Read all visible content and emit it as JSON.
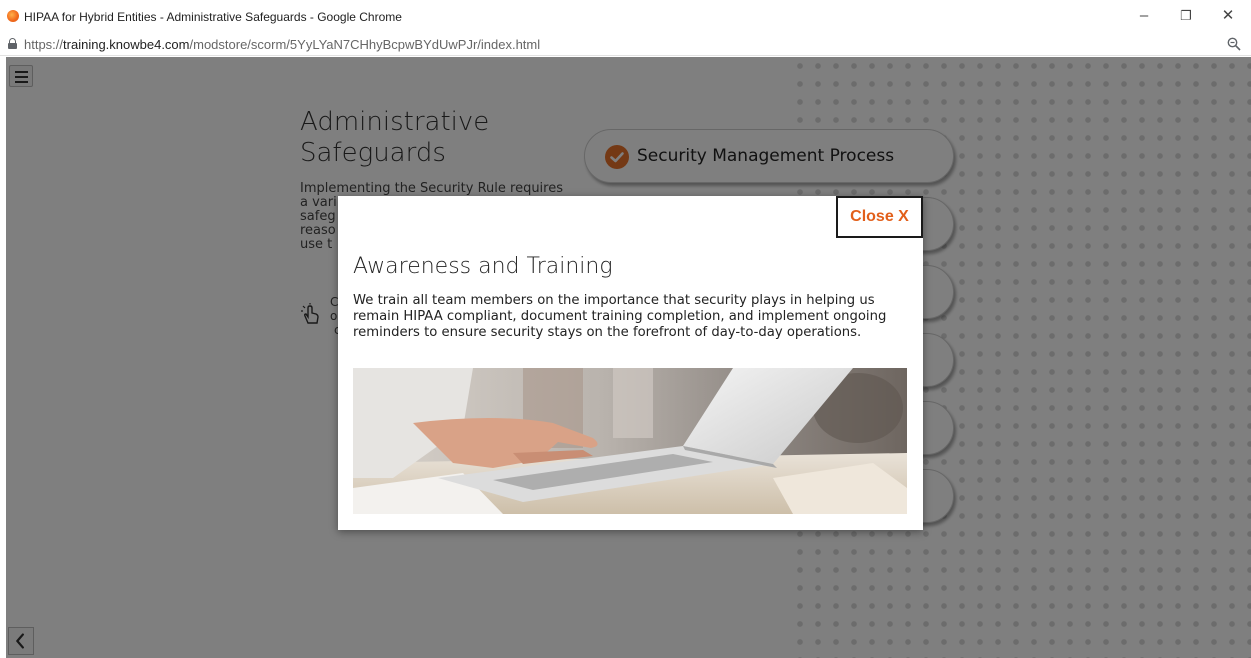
{
  "window": {
    "title": "HIPAA for Hybrid Entities - Administrative Safeguards - Google Chrome",
    "minimize_glyph": "–",
    "restore_glyph": "❐",
    "close_glyph": "✕"
  },
  "address_bar": {
    "url_scheme": "https://",
    "url_host": "training.knowbe4.com",
    "url_path": "/modstore/scorm/5YyLYaN7CHhyBcpwBYdUwPJr/index.html"
  },
  "page": {
    "title": "Administrative Safeguards",
    "intro_lines": [
      "Implementing the Security Rule requires",
      "a vari",
      "safeg",
      "reaso",
      "use t"
    ],
    "instruction_lines": [
      "C",
      "o",
      "c"
    ],
    "pills": [
      {
        "label": "Security Management Process",
        "completed": true
      }
    ],
    "back_glyph": "<"
  },
  "modal": {
    "close_label": "Close X",
    "title": "Awareness and Training",
    "body": "We train all team members on the importance that security plays in helping us remain HIPAA compliant, document training completion, and implement ongoing reminders to ensure security stays on the forefront of day-to-day operations.",
    "image": "laptop-typing-photo"
  },
  "colors": {
    "accent": "#e8722a",
    "close_text": "#e25f1a",
    "overlay": "rgba(0,0,0,0.5)"
  }
}
